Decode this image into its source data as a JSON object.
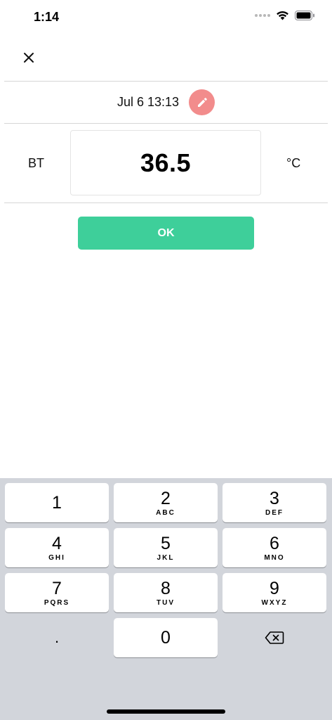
{
  "status_bar": {
    "time": "1:14"
  },
  "header": {
    "close_icon": "close-icon"
  },
  "entry": {
    "datetime": "Jul 6 13:13",
    "edit_icon": "pencil-icon",
    "label": "BT",
    "value": "36.5",
    "unit": "°C"
  },
  "actions": {
    "ok_label": "OK"
  },
  "keyboard": {
    "keys": [
      {
        "num": "1",
        "letters": ""
      },
      {
        "num": "2",
        "letters": "ABC"
      },
      {
        "num": "3",
        "letters": "DEF"
      },
      {
        "num": "4",
        "letters": "GHI"
      },
      {
        "num": "5",
        "letters": "JKL"
      },
      {
        "num": "6",
        "letters": "MNO"
      },
      {
        "num": "7",
        "letters": "PQRS"
      },
      {
        "num": "8",
        "letters": "TUV"
      },
      {
        "num": "9",
        "letters": "WXYZ"
      },
      {
        "num": "0",
        "letters": ""
      }
    ],
    "decimal": ".",
    "delete_icon": "backspace-icon"
  },
  "colors": {
    "accent": "#3ecf9a",
    "edit": "#f28c8c",
    "keyboard_bg": "#d2d5db"
  }
}
